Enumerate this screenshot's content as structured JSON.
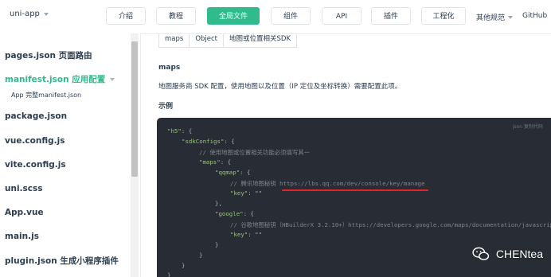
{
  "topbar": {
    "brand": "uni-app",
    "nav": [
      {
        "label": "介绍",
        "active": false
      },
      {
        "label": "教程",
        "active": false
      },
      {
        "label": "全局文件",
        "active": true
      },
      {
        "label": "组件",
        "active": false
      },
      {
        "label": "API",
        "active": false
      },
      {
        "label": "插件",
        "active": false
      },
      {
        "label": "工程化",
        "active": false
      }
    ],
    "more": "其他规范",
    "github": "GitHub"
  },
  "sidebar": {
    "items": [
      {
        "label": "pages.json 页面路由"
      },
      {
        "label": "manifest.json 应用配置",
        "active": true
      },
      {
        "label": "App 完整manifest.json",
        "sub": true
      },
      {
        "label": "package.json"
      },
      {
        "label": "vue.config.js"
      },
      {
        "label": "vite.config.js"
      },
      {
        "label": "uni.scss"
      },
      {
        "label": "App.vue"
      },
      {
        "label": "main.js"
      },
      {
        "label": "plugin.json 生成小程序插件"
      }
    ]
  },
  "main": {
    "table_cells": [
      "maps",
      "Object",
      "地图或位置相关SDK"
    ],
    "section_title": "maps",
    "description": "地图服务商 SDK 配置，使用地图以及位置（IP 定位及坐标转换）需要配置此项。",
    "example_title": "示例",
    "code_tools": "json  复制代码",
    "code": {
      "l1_key": "\"h5\"",
      "l2_key": "\"sdkConfigs\"",
      "l3_cmt": "// 使用地图或位置相关功能必须填写其一",
      "l4_key": "\"maps\"",
      "l5_key": "\"qqmap\"",
      "l6_cmt": "// 腾讯地图秘钥 https://lbs.qq.com/dev/console/key/manage",
      "l7_key": "\"key\"",
      "l7_val": "\"\"",
      "l9_key": "\"google\"",
      "l10_cmt": "// 谷歌地图秘钥（HBuilderX 3.2.10+）https://developers.google.com/maps/documentation/javascript/get-api-key",
      "l11_key": "\"key\"",
      "l11_val": "\"\""
    }
  },
  "watermark": "CHENtea"
}
